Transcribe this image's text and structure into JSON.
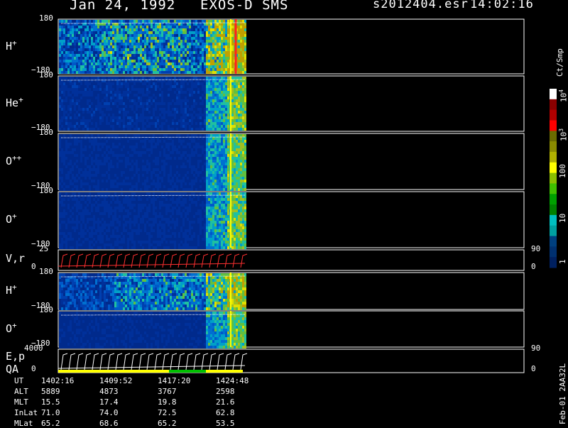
{
  "header": {
    "date": "Jan 24, 1992",
    "mission": "EXOS-D SMS",
    "file": "s2012404.esr",
    "time": "14:02:16"
  },
  "chart_data": [
    {
      "type": "heatmap",
      "panel": "H+",
      "label": "H",
      "sup": "+",
      "ytop": "180",
      "ybottom": "−180",
      "ylim": [
        -180,
        180
      ],
      "intensity": 0.65
    },
    {
      "type": "heatmap",
      "panel": "He+",
      "label": "He",
      "sup": "+",
      "ytop": "180",
      "ybottom": "−180",
      "ylim": [
        -180,
        180
      ],
      "intensity": 0.22
    },
    {
      "type": "heatmap",
      "panel": "O++",
      "label": "O",
      "sup": "++",
      "ytop": "180",
      "ybottom": "−180",
      "ylim": [
        -180,
        180
      ],
      "intensity": 0.18
    },
    {
      "type": "heatmap",
      "panel": "O+",
      "label": "O",
      "sup": "+",
      "ytop": "180",
      "ybottom": "−180",
      "ylim": [
        -180,
        180
      ],
      "intensity": 0.2
    },
    {
      "type": "line",
      "panel": "V,r",
      "label": "V,r",
      "ytop": "25",
      "ybottom": "0",
      "ylim": [
        0,
        25
      ],
      "right_top": "90",
      "right_bottom": "0"
    },
    {
      "type": "heatmap",
      "panel": "H+ (lower)",
      "label": "H",
      "sup": "+",
      "ytop": "180",
      "ybottom": "−180",
      "ylim": [
        -180,
        180
      ],
      "intensity": 0.45
    },
    {
      "type": "heatmap",
      "panel": "O+ (lower)",
      "label": "O",
      "sup": "+",
      "ytop": "180",
      "ybottom": "−180",
      "ylim": [
        -180,
        180
      ],
      "intensity": 0.15
    },
    {
      "type": "line",
      "panel": "E,p QA",
      "label": "E,p",
      "label2": "QA",
      "ytop": "4000",
      "ybottom": "0",
      "ylim": [
        0,
        4000
      ],
      "right_top": "90",
      "right_bottom": "0"
    }
  ],
  "colorbar": {
    "unit": "Ct/Smp",
    "ticks": [
      {
        "base": "10",
        "exp": "4"
      },
      {
        "base": "10",
        "exp": "3"
      },
      {
        "base": "100",
        "exp": ""
      },
      {
        "base": "10",
        "exp": ""
      },
      {
        "base": "1",
        "exp": ""
      }
    ],
    "colors": [
      "#ffffff",
      "#8b0000",
      "#b00000",
      "#ff0000",
      "#6b6b00",
      "#8b8b00",
      "#b0b000",
      "#ffff00",
      "#8bc000",
      "#40c000",
      "#00a000",
      "#008000",
      "#00c0c0",
      "#00a0a0",
      "#004080",
      "#003070",
      "#002060"
    ]
  },
  "footer": {
    "rows": [
      {
        "name": "UT",
        "values": [
          "1402:16",
          "1409:52",
          "1417:20",
          "1424:48"
        ]
      },
      {
        "name": "ALT",
        "values": [
          "5889",
          "4873",
          "3767",
          "2598"
        ]
      },
      {
        "name": "MLT",
        "values": [
          "15.5",
          "17.4",
          "19.8",
          "21.6"
        ]
      },
      {
        "name": "InLat",
        "values": [
          "71.0",
          "74.0",
          "72.5",
          "62.8"
        ]
      },
      {
        "name": "MLat",
        "values": [
          "65.2",
          "68.6",
          "65.2",
          "53.5"
        ]
      }
    ],
    "stamp": "Feb-01 2AA32L"
  }
}
